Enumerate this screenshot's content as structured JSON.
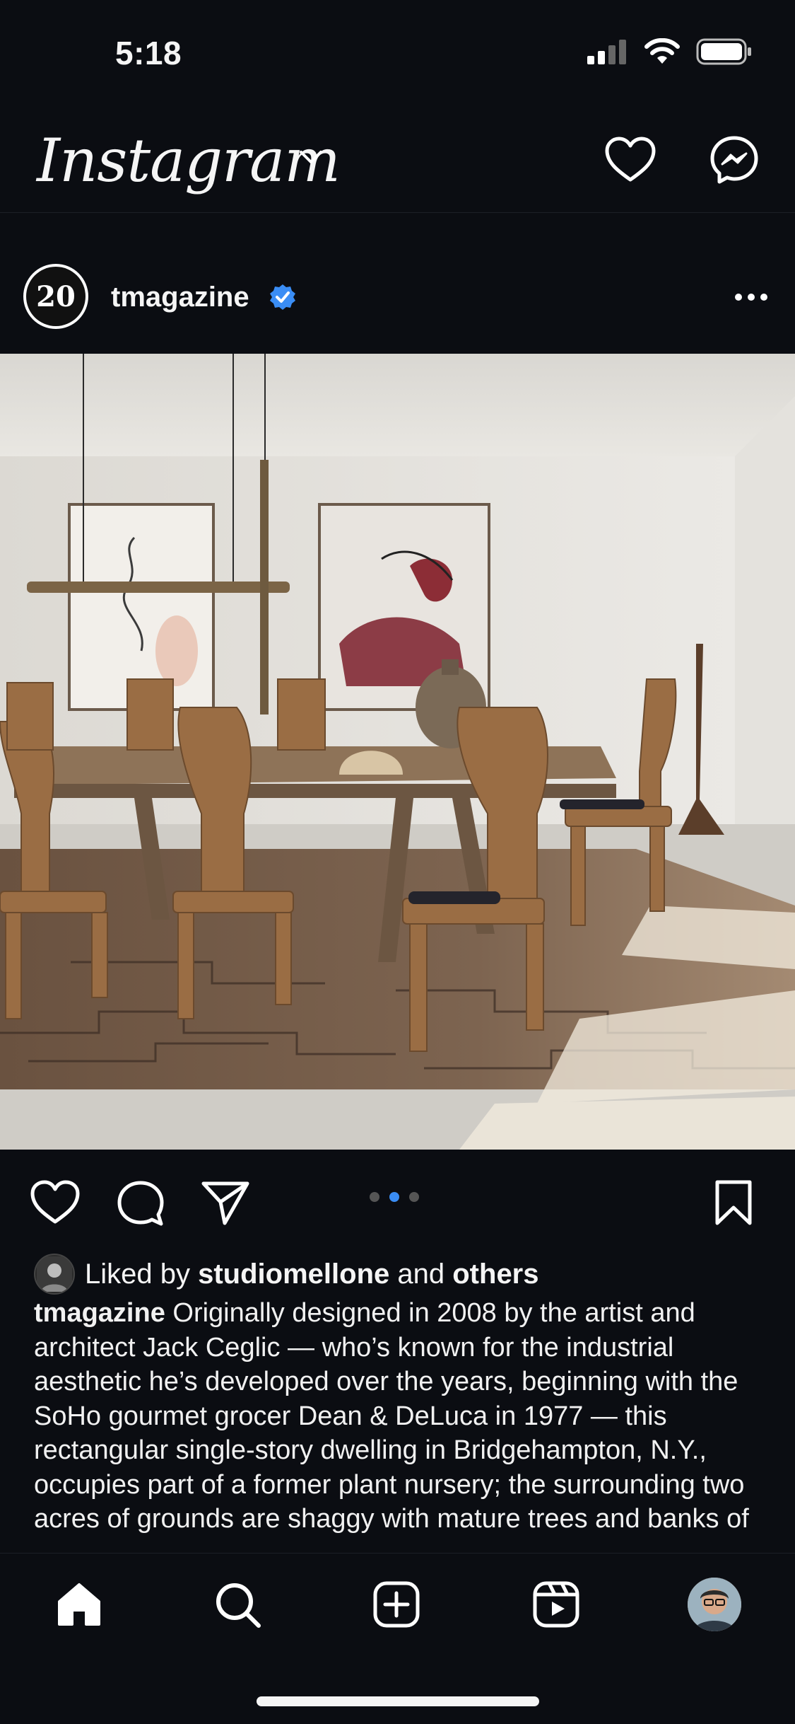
{
  "status": {
    "time": "5:18"
  },
  "header": {
    "logo": "Instagram"
  },
  "post": {
    "avatar_text": "20",
    "username": "tmagazine",
    "carousel": {
      "count": 3,
      "active_index": 1
    },
    "liked_prefix": "Liked by",
    "liked_user": "studiomellone",
    "liked_and": "and",
    "liked_others": "others",
    "caption_user": "tmagazine",
    "caption_text": "Originally designed in 2008 by the artist and architect Jack Ceglic — who’s known for the industrial aesthetic he’s developed over the years, beginning with the SoHo gourmet grocer Dean & DeLuca in 1977 — this rectangular single-story dwelling in Bridgehampton, N.Y., occupies part of a former plant nursery; the surrounding two acres of grounds are shaggy with mature trees and banks of"
  },
  "icons": {
    "header": [
      "heart-icon",
      "messenger-icon"
    ],
    "actions": [
      "like-icon",
      "comment-icon",
      "share-icon",
      "bookmark-icon"
    ],
    "tabs": [
      "home-icon",
      "search-icon",
      "create-icon",
      "reels-icon",
      "profile-avatar"
    ]
  },
  "colors": {
    "background": "#0b0d12",
    "verified": "#3a8df5",
    "carousel_active": "#3a8df5"
  }
}
